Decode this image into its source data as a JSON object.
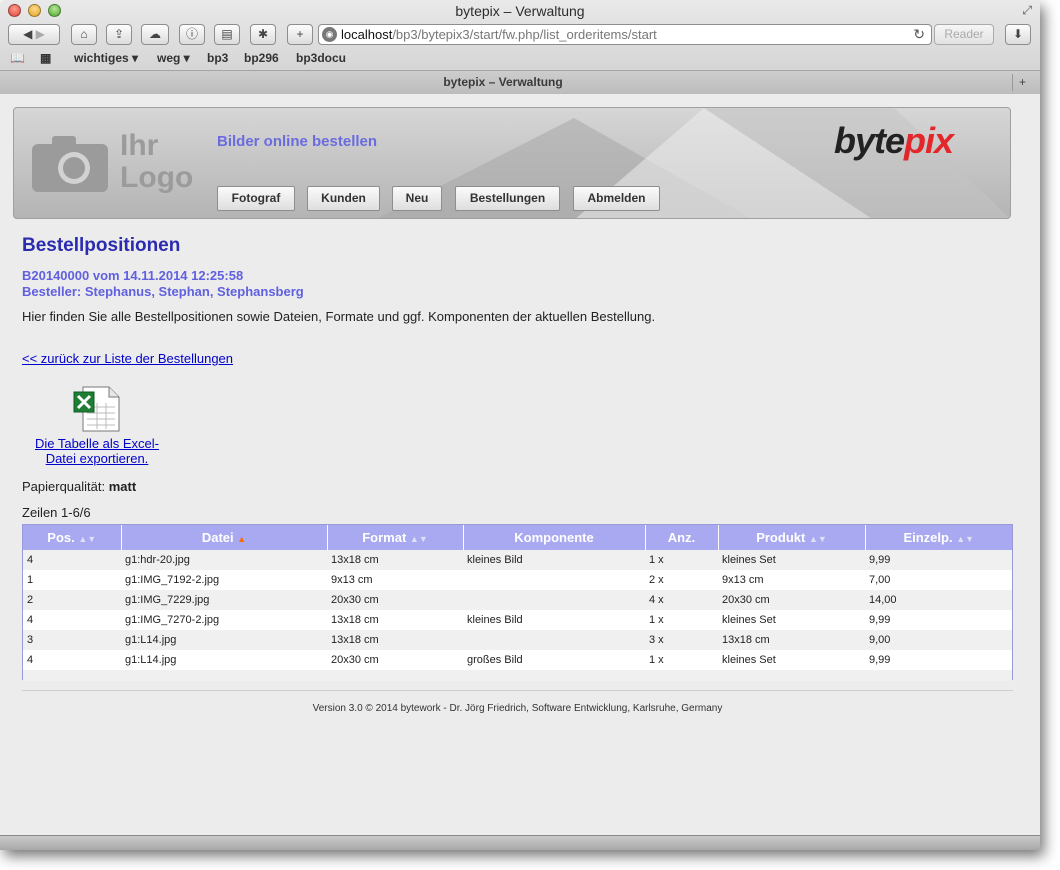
{
  "browser": {
    "window_title": "bytepix – Verwaltung",
    "url_host": "localhost",
    "url_path": "/bp3/bytepix3/start/fw.php/list_orderitems/start",
    "reader_label": "Reader",
    "tab_title": "bytepix – Verwaltung",
    "bookmarks": [
      "wichtiges ▾",
      "weg ▾",
      "bp3",
      "bp296",
      "bp3docu"
    ]
  },
  "header": {
    "logo_line1": "Ihr",
    "logo_line2": "Logo",
    "site_title": "Bilder online bestellen",
    "brand_a": "byte",
    "brand_b": "pix",
    "nav": [
      "Fotograf",
      "Kunden",
      "Neu",
      "Bestellungen",
      "Abmelden"
    ]
  },
  "main": {
    "title": "Bestellpositionen",
    "order_line": "B20140000 vom 14.11.2014 12:25:58",
    "customer_line": "Besteller: Stephanus, Stephan, Stephansberg",
    "description": "Hier finden Sie alle Bestellpositionen sowie Dateien, Formate und ggf. Komponenten der aktuellen Bestellung.",
    "back_link": "<< zurück zur Liste der Bestellungen",
    "excel_link_line1": "Die Tabelle als Excel-",
    "excel_link_line2": "Datei exportieren.",
    "paper_label": "Papierqualität:",
    "paper_value": "matt",
    "rows_info": "Zeilen 1-6/6"
  },
  "table": {
    "columns": [
      "Pos.",
      "Datei",
      "Format",
      "Komponente",
      "Anz.",
      "Produkt",
      "Einzelp."
    ],
    "rows": [
      [
        "4",
        "g1:hdr-20.jpg",
        "13x18 cm",
        "kleines Bild",
        "1 x",
        "kleines Set",
        "9,99"
      ],
      [
        "1",
        "g1:IMG_7192-2.jpg",
        "9x13 cm",
        "",
        "2 x",
        "9x13 cm",
        "7,00"
      ],
      [
        "2",
        "g1:IMG_7229.jpg",
        "20x30 cm",
        "",
        "4 x",
        "20x30 cm",
        "14,00"
      ],
      [
        "4",
        "g1:IMG_7270-2.jpg",
        "13x18 cm",
        "kleines Bild",
        "1 x",
        "kleines Set",
        "9,99"
      ],
      [
        "3",
        "g1:L14.jpg",
        "13x18 cm",
        "",
        "3 x",
        "13x18 cm",
        "9,00"
      ],
      [
        "4",
        "g1:L14.jpg",
        "20x30 cm",
        "großes Bild",
        "1 x",
        "kleines Set",
        "9,99"
      ]
    ]
  },
  "footer": {
    "text": "Version 3.0 © 2014 bytework - Dr. Jörg Friedrich, Software Entwicklung, Karlsruhe, Germany"
  }
}
